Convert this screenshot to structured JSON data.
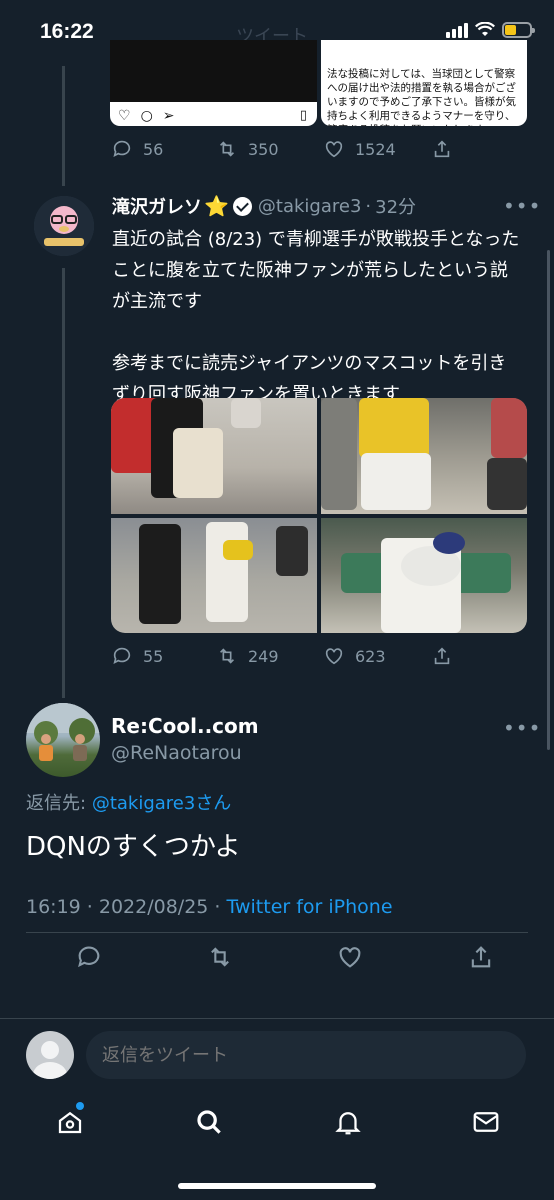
{
  "status_bar": {
    "time": "16:22",
    "header_ghost": "ツイート"
  },
  "prev_tweet": {
    "notice_text": "法な投稿に対しては、当球団として警察への届け出や法的措置を執る場合がございますので予めご了承下さい。皆様が気持ちよく利用できるようマナーを守り、節度ある投稿をお願いいたします。",
    "reply_count": "56",
    "retweet_count": "350",
    "like_count": "1524"
  },
  "main_tweet": {
    "display_name": "滝沢ガレソ",
    "star": "⭐",
    "handle": "@takigare3",
    "dot": "·",
    "time_ago": "32分",
    "text": "直近の試合 (8/23) で青柳選手が敗戦投手となったことに腹を立てた阪神ファンが荒らしたという説が主流です\n\n参考までに読売ジャイアンツのマスコットを引きずり回す阪神ファンを置いときます",
    "reply_count": "55",
    "retweet_count": "249",
    "like_count": "623"
  },
  "reply_tweet": {
    "display_name": "Re:Cool..com",
    "handle": "@ReNaotarou",
    "replying_label": "返信先:",
    "replying_handle": "@takigare3",
    "replying_suffix": "さん",
    "text": "DQNのすくつかよ",
    "timestamp": "16:19 · 2022/08/25 ·",
    "source": "Twitter for iPhone"
  },
  "compose": {
    "placeholder": "返信をツイート"
  },
  "tabs": [
    "home-icon",
    "search-icon",
    "notifications-icon",
    "messages-icon"
  ],
  "colors": {
    "background": "#15202b",
    "accent": "#1d9bf0",
    "muted": "#8899a6"
  }
}
